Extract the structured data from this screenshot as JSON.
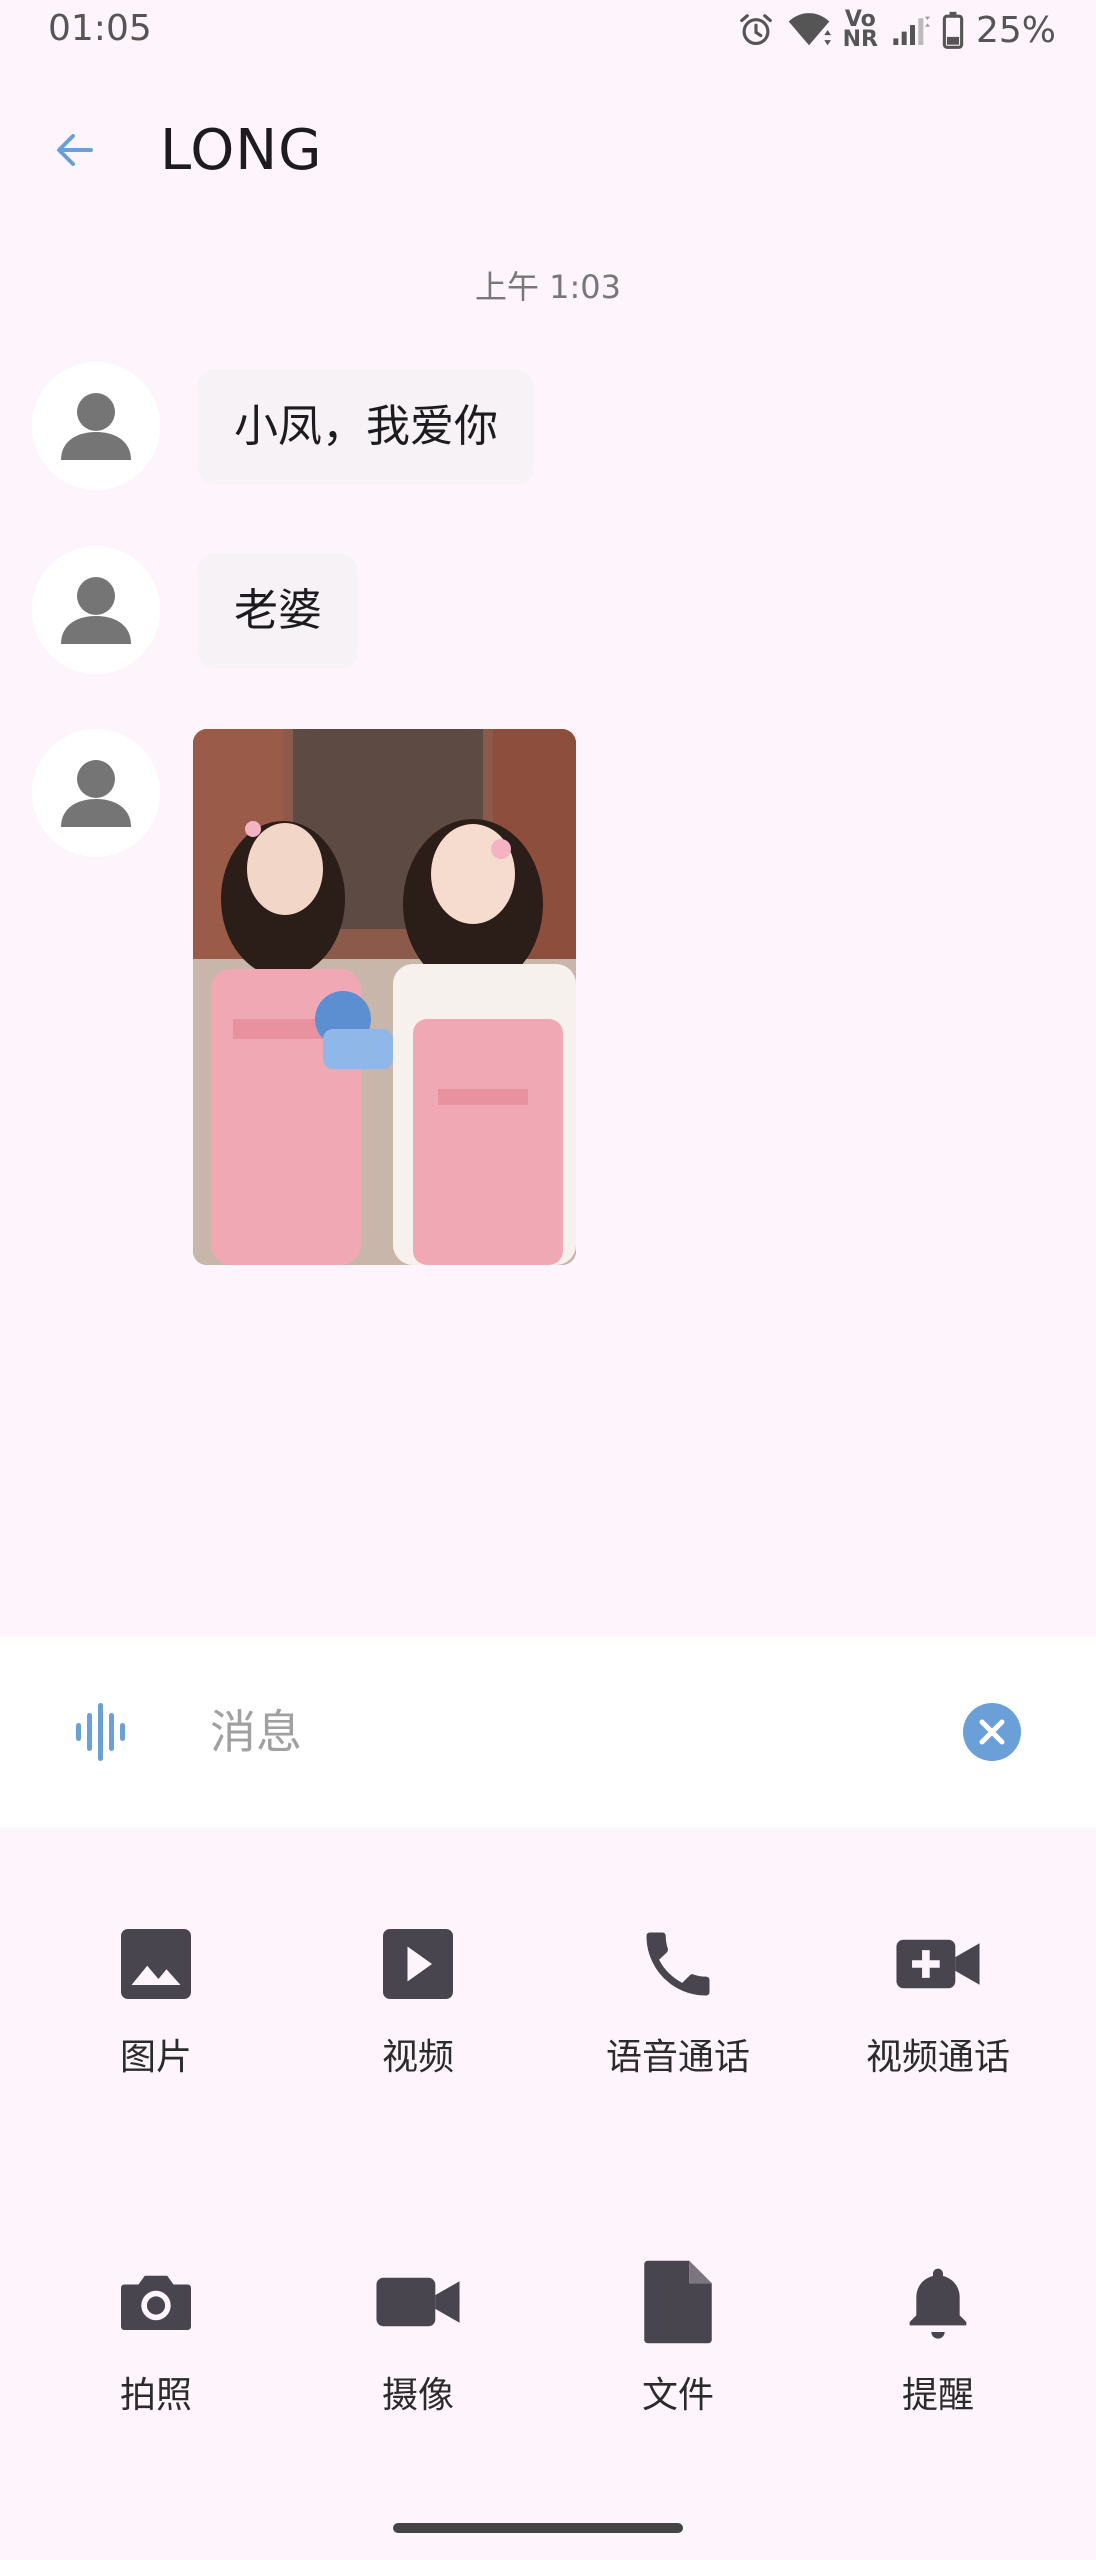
{
  "status_bar": {
    "time": "01:05",
    "network_badge_top": "Vo",
    "network_badge_bottom": "NR",
    "battery": "25%"
  },
  "header": {
    "title": "LONG",
    "back_icon": "arrow-back-icon"
  },
  "chat": {
    "timestamp": "上午 1:03",
    "messages": [
      {
        "type": "text",
        "text": "小凤，我爱你"
      },
      {
        "type": "text",
        "text": "老婆"
      },
      {
        "type": "image",
        "description": "photo"
      }
    ]
  },
  "composer": {
    "placeholder": "消息",
    "voice_icon": "voice-wave-icon",
    "clear_icon": "close-circle-icon"
  },
  "actions": [
    {
      "label": "图片",
      "icon": "image-icon"
    },
    {
      "label": "视频",
      "icon": "video-play-icon"
    },
    {
      "label": "语音通话",
      "icon": "phone-icon"
    },
    {
      "label": "视频通话",
      "icon": "video-call-icon"
    },
    {
      "label": "拍照",
      "icon": "camera-icon"
    },
    {
      "label": "摄像",
      "icon": "videocam-icon"
    },
    {
      "label": "文件",
      "icon": "file-icon"
    },
    {
      "label": "提醒",
      "icon": "bell-icon"
    }
  ],
  "colors": {
    "accent": "#6a9fd8",
    "background": "#fdf5fb",
    "bubble": "#f6f2f6",
    "icon_dark": "#49454f"
  }
}
